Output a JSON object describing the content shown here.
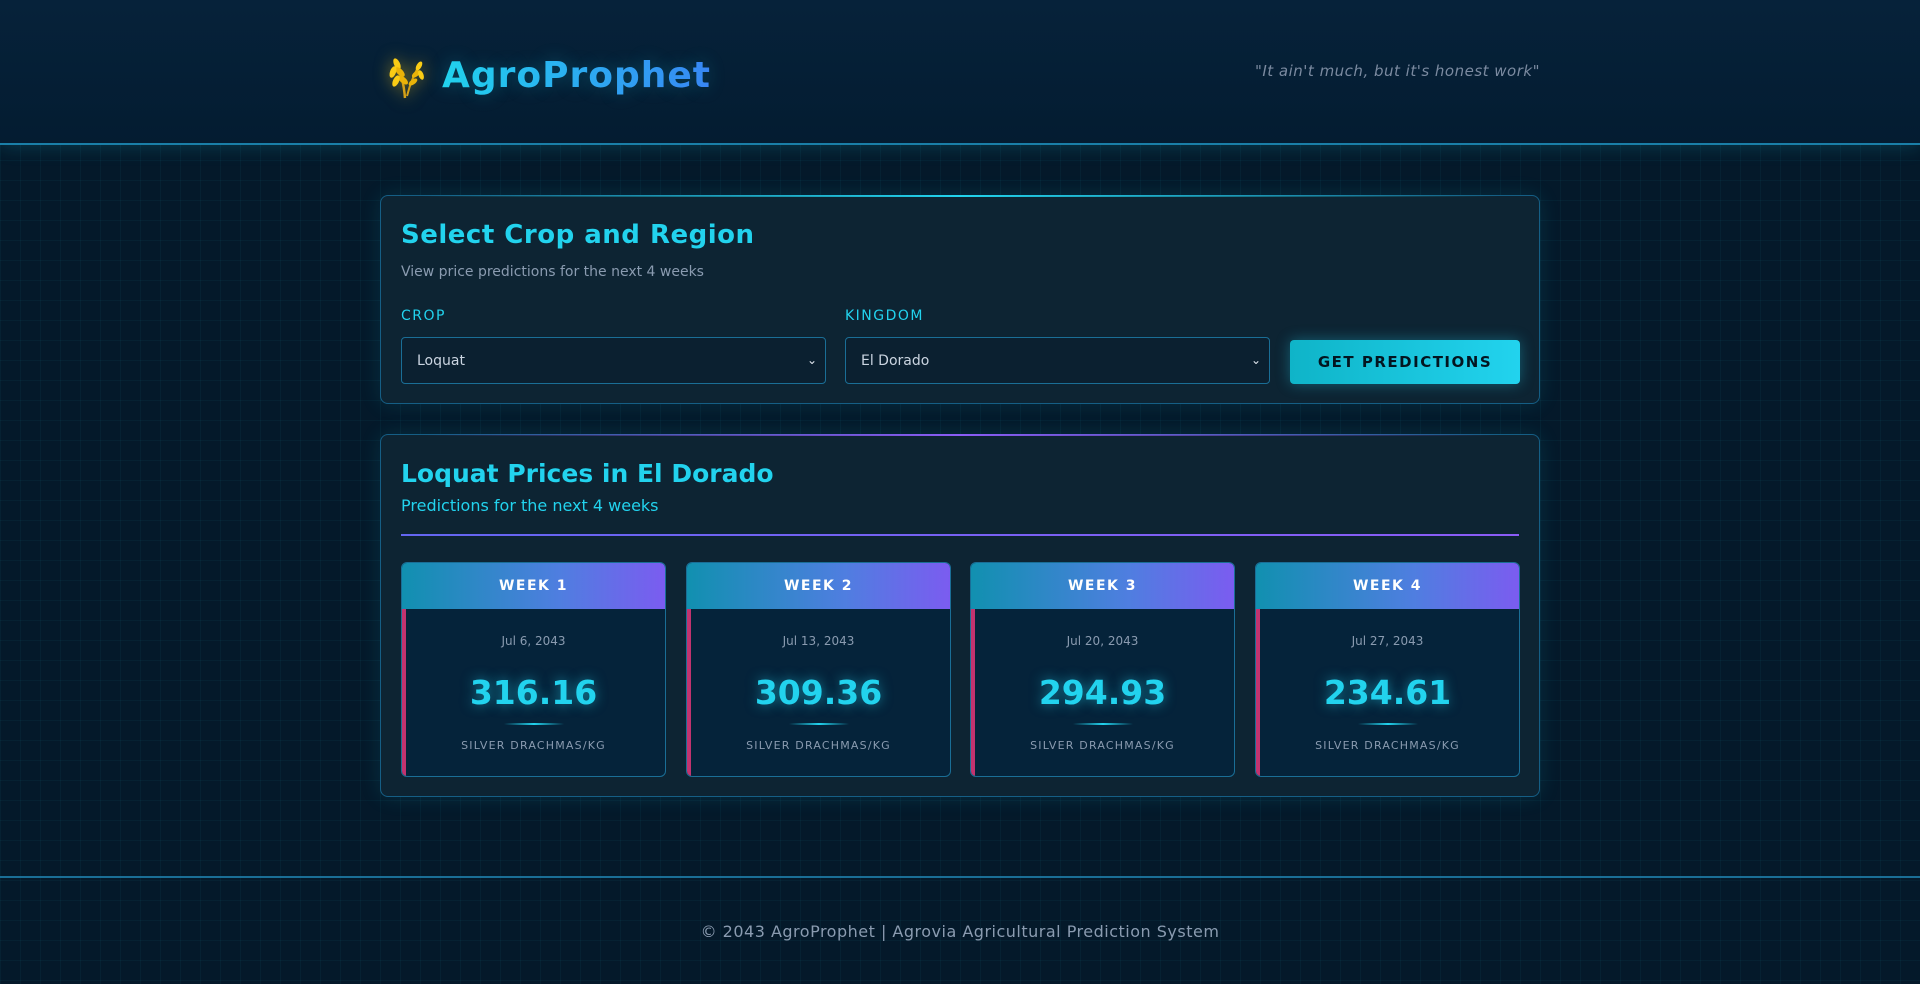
{
  "header": {
    "brand": "AgroProphet",
    "tagline": "\"It ain't much, but it's honest work\"",
    "logo_icon": "wheat-icon"
  },
  "selector": {
    "title": "Select Crop and Region",
    "subtitle": "View price predictions for the next 4 weeks",
    "crop_label": "CROP",
    "crop_value": "Loquat",
    "kingdom_label": "KINGDOM",
    "kingdom_value": "El Dorado",
    "button_label": "GET PREDICTIONS"
  },
  "results": {
    "title": "Loquat Prices in El Dorado",
    "subtitle": "Predictions for the next 4 weeks",
    "weeks": [
      {
        "label": "WEEK 1",
        "date": "Jul 6, 2043",
        "price": "316.16",
        "unit": "SILVER DRACHMAS/KG"
      },
      {
        "label": "WEEK 2",
        "date": "Jul 13, 2043",
        "price": "309.36",
        "unit": "SILVER DRACHMAS/KG"
      },
      {
        "label": "WEEK 3",
        "date": "Jul 20, 2043",
        "price": "294.93",
        "unit": "SILVER DRACHMAS/KG"
      },
      {
        "label": "WEEK 4",
        "date": "Jul 27, 2043",
        "price": "234.61",
        "unit": "SILVER DRACHMAS/KG"
      }
    ]
  },
  "footer": {
    "text": "© 2043 AgroProphet | Agrovia Agricultural Prediction System"
  },
  "colors": {
    "accent": "#22d3ee",
    "accent_purple": "#8b5cf6",
    "card_bar": "#c2336f",
    "background": "#04192a"
  }
}
